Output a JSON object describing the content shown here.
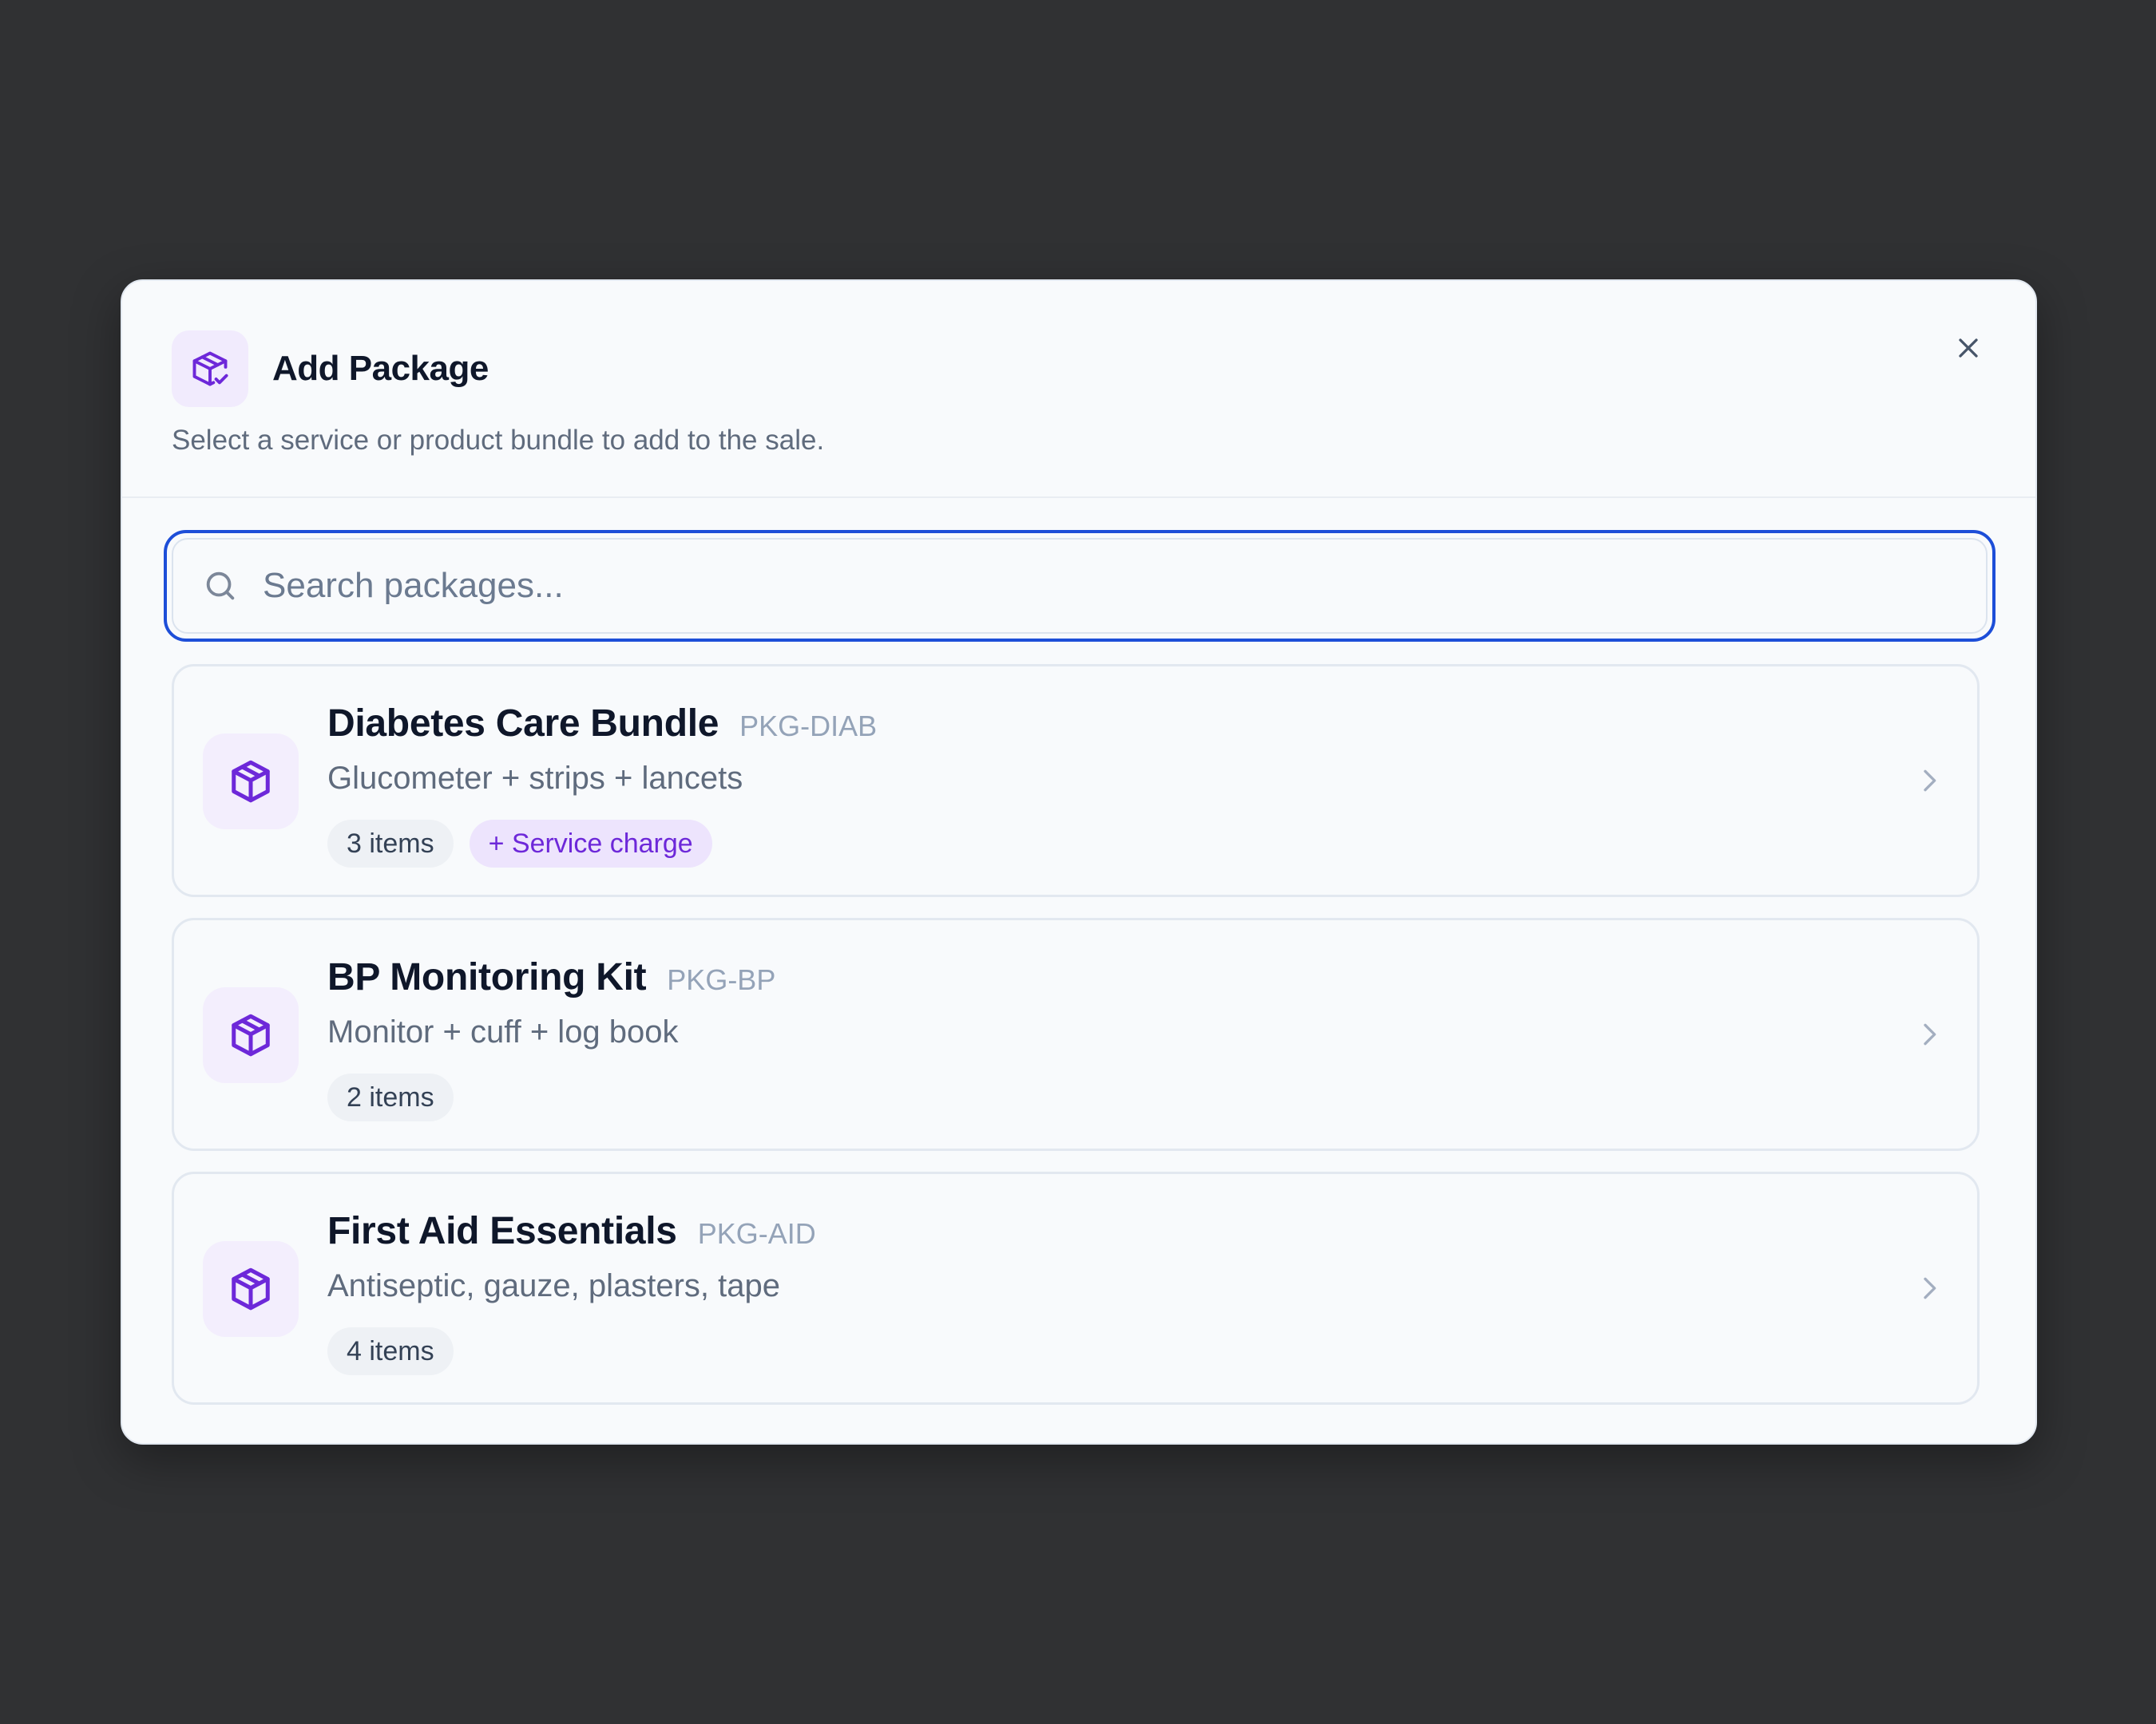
{
  "dialog": {
    "title": "Add Package",
    "subtitle": "Select a service or product bundle to add to the sale.",
    "header_icon": "package-check-icon",
    "close_icon": "close-icon"
  },
  "search": {
    "placeholder": "Search packages...",
    "value": "",
    "icon": "search-icon"
  },
  "packages": [
    {
      "name": "Diabetes Care Bundle",
      "code": "PKG-DIAB",
      "description": "Glucometer + strips + lancets",
      "items_label": "3 items",
      "extra_badge": "+ Service charge",
      "icon": "package-icon"
    },
    {
      "name": "BP Monitoring Kit",
      "code": "PKG-BP",
      "description": "Monitor + cuff + log book",
      "items_label": "2 items",
      "icon": "package-icon"
    },
    {
      "name": "First Aid Essentials",
      "code": "PKG-AID",
      "description": "Antiseptic, gauze, plasters, tape",
      "items_label": "4 items",
      "icon": "package-icon"
    }
  ],
  "colors": {
    "accent_blue": "#1d4ed8",
    "accent_purple": "#6d28d9",
    "backdrop": "#303133",
    "surface": "#f8fafc"
  }
}
